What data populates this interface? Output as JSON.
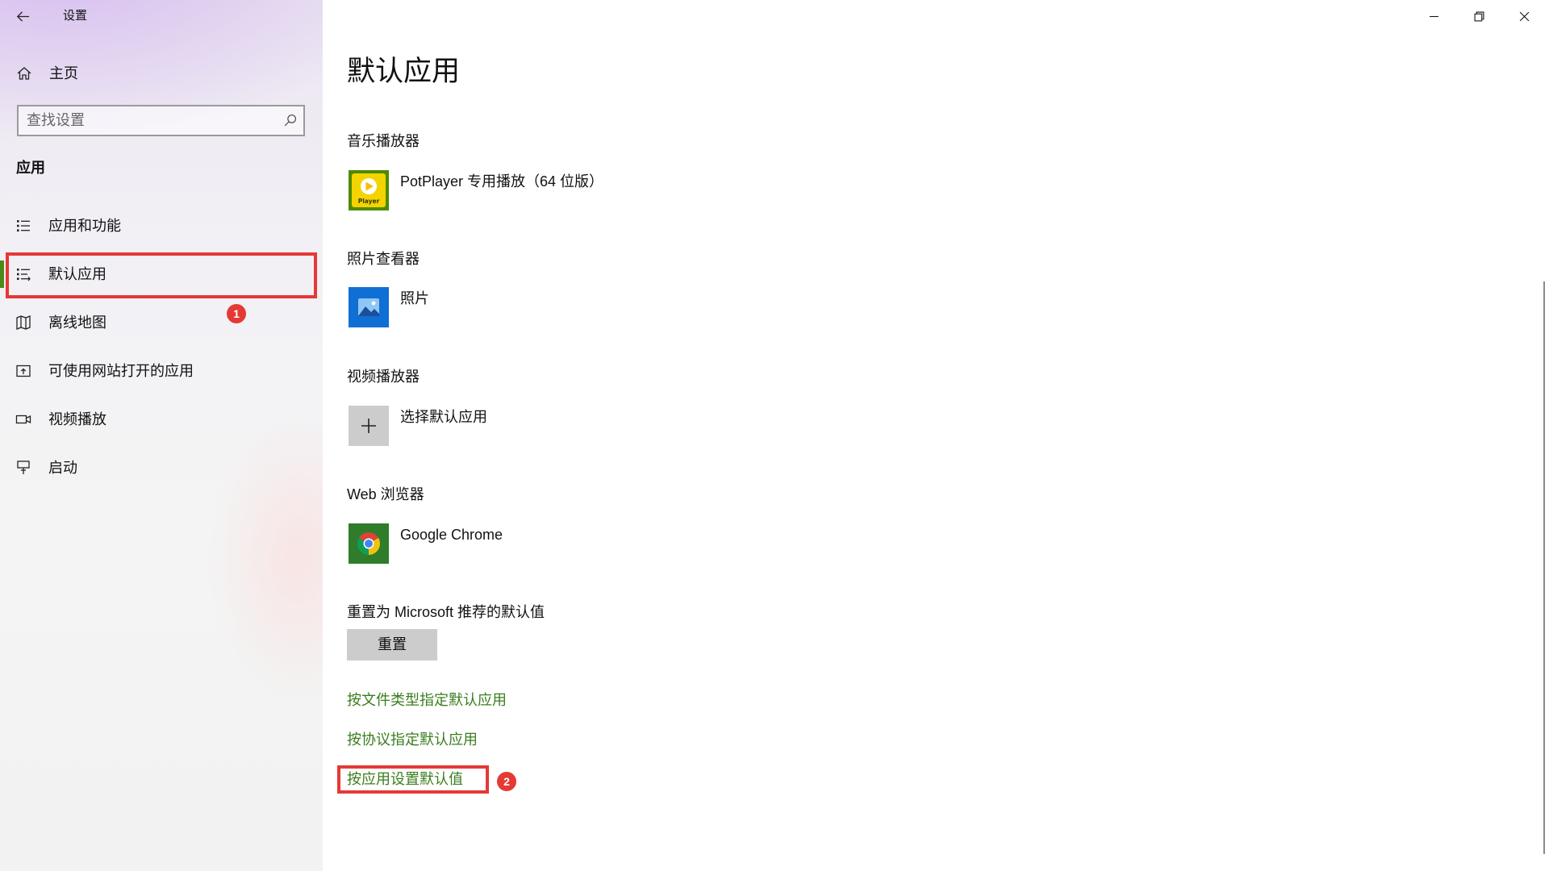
{
  "window": {
    "title": "设置",
    "back_icon": "back-arrow-icon",
    "controls": [
      "minimize-icon",
      "restore-icon",
      "close-icon"
    ]
  },
  "sidebar": {
    "home": {
      "label": "主页",
      "icon": "home-icon"
    },
    "search": {
      "placeholder": "查找设置",
      "icon": "search-icon"
    },
    "section_heading": "应用",
    "items": [
      {
        "label": "应用和功能",
        "icon": "apps-features-icon",
        "selected": false
      },
      {
        "label": "默认应用",
        "icon": "default-apps-icon",
        "selected": true
      },
      {
        "label": "离线地图",
        "icon": "offline-maps-icon",
        "selected": false
      },
      {
        "label": "可使用网站打开的应用",
        "icon": "apps-for-websites-icon",
        "selected": false
      },
      {
        "label": "视频播放",
        "icon": "video-playback-icon",
        "selected": false
      },
      {
        "label": "启动",
        "icon": "startup-icon",
        "selected": false
      }
    ]
  },
  "main": {
    "title": "默认应用",
    "sections": [
      {
        "label": "音乐播放器",
        "app": "PotPlayer 专用播放（64 位版）",
        "icon": "potplayer-icon",
        "icon_text": "Player"
      },
      {
        "label": "照片查看器",
        "app": "照片",
        "icon": "photos-icon"
      },
      {
        "label": "视频播放器",
        "app": "选择默认应用",
        "icon": "plus-icon"
      },
      {
        "label": "Web 浏览器",
        "app": "Google Chrome",
        "icon": "chrome-icon"
      }
    ],
    "reset": {
      "label": "重置为 Microsoft 推荐的默认值",
      "button": "重置"
    },
    "links": [
      "按文件类型指定默认应用",
      "按协议指定默认应用",
      "按应用设置默认值"
    ]
  },
  "annotations": {
    "marker_1": "1",
    "marker_2": "2"
  },
  "colors": {
    "accent_green": "#3a7d1e",
    "selection_bar": "#4a8a1a",
    "annotation_red": "#e53935"
  }
}
